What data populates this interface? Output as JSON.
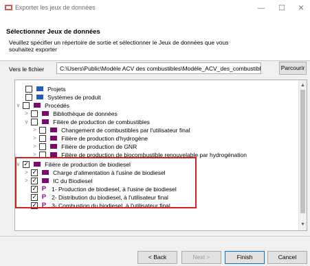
{
  "window": {
    "title": "Exporter les jeux de données"
  },
  "header": {
    "title": "Sélectionner Jeux de données",
    "description": "Veuillez spécifier un répertoire de sortie et sélectionner le Jeux de données que vous souhaitez exporter"
  },
  "file": {
    "label": "Vers le fichier",
    "value": "C:\\Users\\Public\\Modèle ACV des combustibles\\Modèle_ACV_des_combustibles.zip",
    "browse_label": "Parcourir"
  },
  "tree": {
    "items": [
      {
        "label": "Projets",
        "icon": "folder-blue-icon",
        "expander": "",
        "checked": false
      },
      {
        "label": "Systèmes de produit",
        "icon": "folder-blue-icon",
        "expander": "",
        "checked": false
      },
      {
        "label": "Procédés",
        "icon": "folder-purple-icon",
        "expander": "v",
        "checked": false
      },
      {
        "label": "Bibliothèque de données",
        "icon": "folder-purple-icon",
        "expander": ">",
        "checked": false
      },
      {
        "label": "Filière de production de combustibles",
        "icon": "folder-purple-icon",
        "expander": "v",
        "checked": false
      },
      {
        "label": "Changement de combustibles par l'utilisateur final",
        "icon": "folder-purple-icon",
        "expander": ">",
        "checked": false
      },
      {
        "label": "Filière de production d'hydrogène",
        "icon": "folder-purple-icon",
        "expander": ">",
        "checked": false
      },
      {
        "label": "Filière de production de GNR",
        "icon": "folder-purple-icon",
        "expander": ">",
        "checked": false
      },
      {
        "label": "Filière de production de biocombustible renouvelable par hydrogénation",
        "icon": "folder-purple-icon",
        "expander": ">",
        "checked": false
      },
      {
        "label": "Filière de production de biodiesel",
        "icon": "folder-purple-icon",
        "expander": "v",
        "checked": true
      },
      {
        "label": "Charge d'alimentation à l'usine de biodiesel",
        "icon": "folder-purple-icon",
        "expander": ">",
        "checked": true
      },
      {
        "label": "IC du Biodiesel",
        "icon": "folder-purple-icon",
        "expander": ">",
        "checked": true
      },
      {
        "label": "1- Production de biodiesel, à l'usine de biodiesel",
        "icon": "process-p-icon",
        "expander": "",
        "checked": true
      },
      {
        "label": "2- Distribution du biodiesel, à l'utilisateur final",
        "icon": "process-p-icon",
        "expander": "",
        "checked": true
      },
      {
        "label": "3- Combustion du biodiesel, à l'utilisateur final",
        "icon": "process-p-icon",
        "expander": "",
        "checked": true
      }
    ]
  },
  "buttons": {
    "back": "< Back",
    "next": "Next >",
    "finish": "Finish",
    "cancel": "Cancel"
  },
  "colors": {
    "process_icon": "#8b0a8b",
    "folder_blue": "#1e5db8",
    "folder_purple": "#7a0a6e",
    "highlight": "#d32020"
  }
}
